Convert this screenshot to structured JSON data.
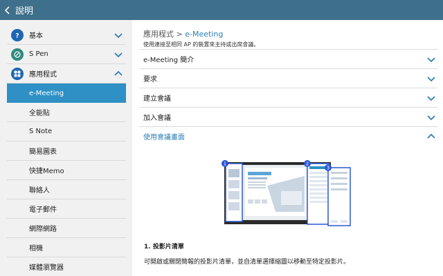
{
  "header": {
    "title": "說明"
  },
  "sidebar": {
    "sections": [
      {
        "label": "基本",
        "icon": "question-icon"
      },
      {
        "label": "S Pen",
        "icon": "pen-icon"
      },
      {
        "label": "應用程式",
        "icon": "apps-grid-icon"
      }
    ],
    "apps": [
      "e-Meeting",
      "全能貼",
      "S Note",
      "簡易圖表",
      "快捷Memo",
      "聯絡人",
      "電子郵件",
      "網際網路",
      "相機",
      "媒體瀏覽器"
    ]
  },
  "main": {
    "breadcrumb_parent": "應用程式",
    "breadcrumb_sep": ">",
    "breadcrumb_current": "e-Meeting",
    "description": "使用連接至相同 AP 的裝置來主持或出席會議。",
    "rows": [
      "e-Meeting 簡介",
      "要求",
      "建立會議",
      "加入會議",
      "使用會議畫面"
    ],
    "figure_callouts": [
      "1",
      "2",
      "3"
    ],
    "section_title": "1. 投影片清單",
    "section_text": "可開啟或關閉簡報的投影片清單，並自清單選擇縮圖以移動至特定投影片。"
  },
  "colors": {
    "header_bg": "#3e6f8b",
    "accent": "#2e90c4",
    "link": "#2e7fb5"
  }
}
